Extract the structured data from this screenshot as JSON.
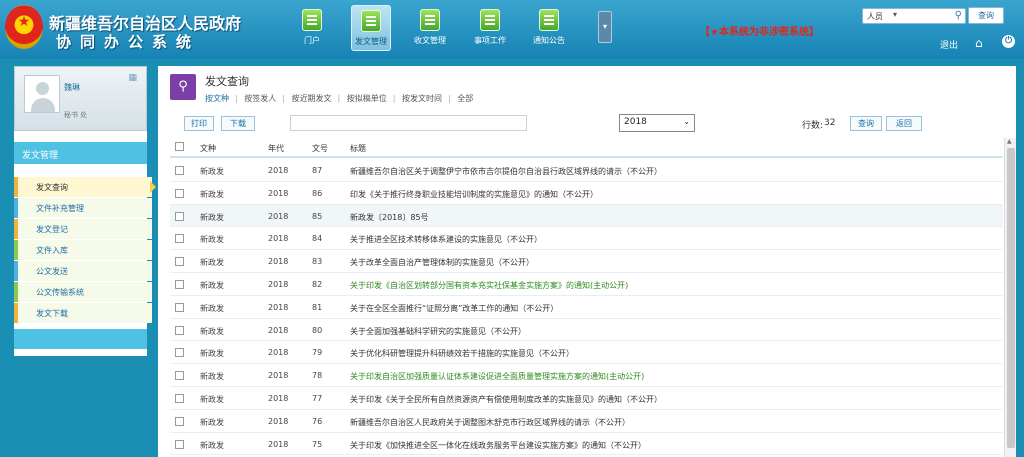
{
  "header": {
    "title_line1": "新疆维吾尔自治区人民政府",
    "title_line2": "协同办公系统",
    "nav": [
      {
        "label": "门户"
      },
      {
        "label": "发文管理"
      },
      {
        "label": "收文管理"
      },
      {
        "label": "事项工作"
      },
      {
        "label": "通知公告"
      }
    ],
    "notice": "【★本系统为非涉密系统】",
    "search_select": "人员",
    "search_button": "查询",
    "logout": "退出"
  },
  "sidebar": {
    "user_name": "魏琳",
    "user_dept": "秘书 处",
    "section": "发文管理",
    "items": [
      {
        "label": "发文查询"
      },
      {
        "label": "文件补充管理"
      },
      {
        "label": "发文登记"
      },
      {
        "label": "文件入库"
      },
      {
        "label": "公文发送"
      },
      {
        "label": "公文传输系统"
      },
      {
        "label": "发文下载"
      }
    ]
  },
  "main": {
    "title": "发文查询",
    "quick_links": [
      "按文种",
      "按签发人",
      "按近期发文",
      "按拟稿单位",
      "按发文时间",
      "全部"
    ],
    "toolbar": {
      "print": "打印",
      "download": "下载",
      "year": "2018",
      "rows_label": "行数:",
      "rows_value": "32",
      "query": "查询",
      "reset": "返回"
    },
    "columns": {
      "type": "文种",
      "year": "年代",
      "num": "文号",
      "title": "标题"
    },
    "rows": [
      {
        "type": "新政发",
        "year": "2018",
        "num": "87",
        "title": "新疆维吾尔自治区关于调整伊宁市依市吉尔提伯尔自治县行政区域界线的请示（不公开）",
        "color": "normal"
      },
      {
        "type": "新政发",
        "year": "2018",
        "num": "86",
        "title": "印发《关于推行终身职业技能培训制度的实施意见》的通知（不公开）",
        "color": "normal"
      },
      {
        "type": "新政发",
        "year": "2018",
        "num": "85",
        "title": "新政发〔2018〕85号",
        "color": "normal"
      },
      {
        "type": "新政发",
        "year": "2018",
        "num": "84",
        "title": "关于推进全区技术转移体系建设的实施意见（不公开）",
        "color": "normal"
      },
      {
        "type": "新政发",
        "year": "2018",
        "num": "83",
        "title": "关于改革全面自治产管理体制的实施意见（不公开）",
        "color": "normal"
      },
      {
        "type": "新政发",
        "year": "2018",
        "num": "82",
        "title": "关于印发《自治区划转部分国有资本充实社保基金实施方案》的通知(主动公开)",
        "color": "green"
      },
      {
        "type": "新政发",
        "year": "2018",
        "num": "81",
        "title": "关于在全区全面推行“证照分离”改革工作的通知（不公开）",
        "color": "normal"
      },
      {
        "type": "新政发",
        "year": "2018",
        "num": "80",
        "title": "关于全面加强基础科学研究的实施意见（不公开）",
        "color": "normal"
      },
      {
        "type": "新政发",
        "year": "2018",
        "num": "79",
        "title": "关于优化科研管理提升科研绩效若干措施的实施意见（不公开）",
        "color": "normal"
      },
      {
        "type": "新政发",
        "year": "2018",
        "num": "78",
        "title": "关于印发自治区加强质量认证体系建设促进全面质量管理实施方案的通知(主动公开)",
        "color": "green"
      },
      {
        "type": "新政发",
        "year": "2018",
        "num": "77",
        "title": "关于印发《关于全民所有自然资源资产有偿使用制度改革的实施意见》的通知（不公开）",
        "color": "normal"
      },
      {
        "type": "新政发",
        "year": "2018",
        "num": "76",
        "title": "新疆维吾尔自治区人民政府关于调整图木舒克市行政区域界线的请示（不公开）",
        "color": "normal"
      },
      {
        "type": "新政发",
        "year": "2018",
        "num": "75",
        "title": "关于印发《加快推进全区一体化在线政务服务平台建设实施方案》的通知（不公开）",
        "color": "normal"
      }
    ]
  },
  "colors": {
    "header": "#1783b4",
    "accent": "#4fc1e2",
    "notice": "#e0261c",
    "link": "#1d6fa3",
    "public": "#2e8b1f"
  }
}
